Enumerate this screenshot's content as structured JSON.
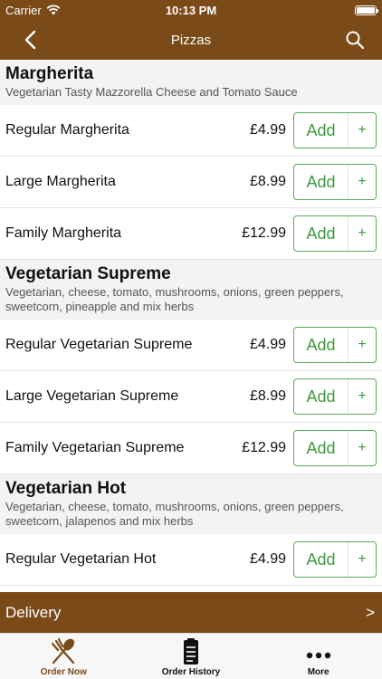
{
  "status_bar": {
    "carrier": "Carrier",
    "time": "10:13 PM"
  },
  "nav": {
    "title": "Pizzas"
  },
  "sections": [
    {
      "title": "Margherita",
      "description": "Vegetarian Tasty Mazzorella Cheese and Tomato Sauce",
      "items": [
        {
          "name": "Regular Margherita",
          "price": "£4.99"
        },
        {
          "name": "Large Margherita",
          "price": "£8.99"
        },
        {
          "name": "Family Margherita",
          "price": "£12.99"
        }
      ]
    },
    {
      "title": "Vegetarian Supreme",
      "description": "Vegetarian, cheese, tomato, mushrooms, onions, green peppers, sweetcorn, pineapple and mix herbs",
      "items": [
        {
          "name": "Regular Vegetarian Supreme",
          "price": "£4.99"
        },
        {
          "name": "Large Vegetarian Supreme",
          "price": "£8.99"
        },
        {
          "name": "Family Vegetarian Supreme",
          "price": "£12.99"
        }
      ]
    },
    {
      "title": "Vegetarian Hot",
      "description": "Vegetarian, cheese, tomato, mushrooms, onions, green peppers, sweetcorn, jalapenos and mix herbs",
      "items": [
        {
          "name": "Regular Vegetarian Hot",
          "price": "£4.99"
        },
        {
          "name": "",
          "price": ""
        }
      ]
    }
  ],
  "buttons": {
    "add_label": "Add",
    "add_plus": "+"
  },
  "delivery": {
    "label": "Delivery",
    "arrow": ">"
  },
  "tabs": [
    {
      "label": "Order Now",
      "icon": "fork-knife-icon"
    },
    {
      "label": "Order History",
      "icon": "clipboard-icon"
    },
    {
      "label": "More",
      "icon": "more-dots-icon"
    }
  ],
  "colors": {
    "brand_brown": "#7a4a18",
    "add_green": "#3e9a3e"
  }
}
